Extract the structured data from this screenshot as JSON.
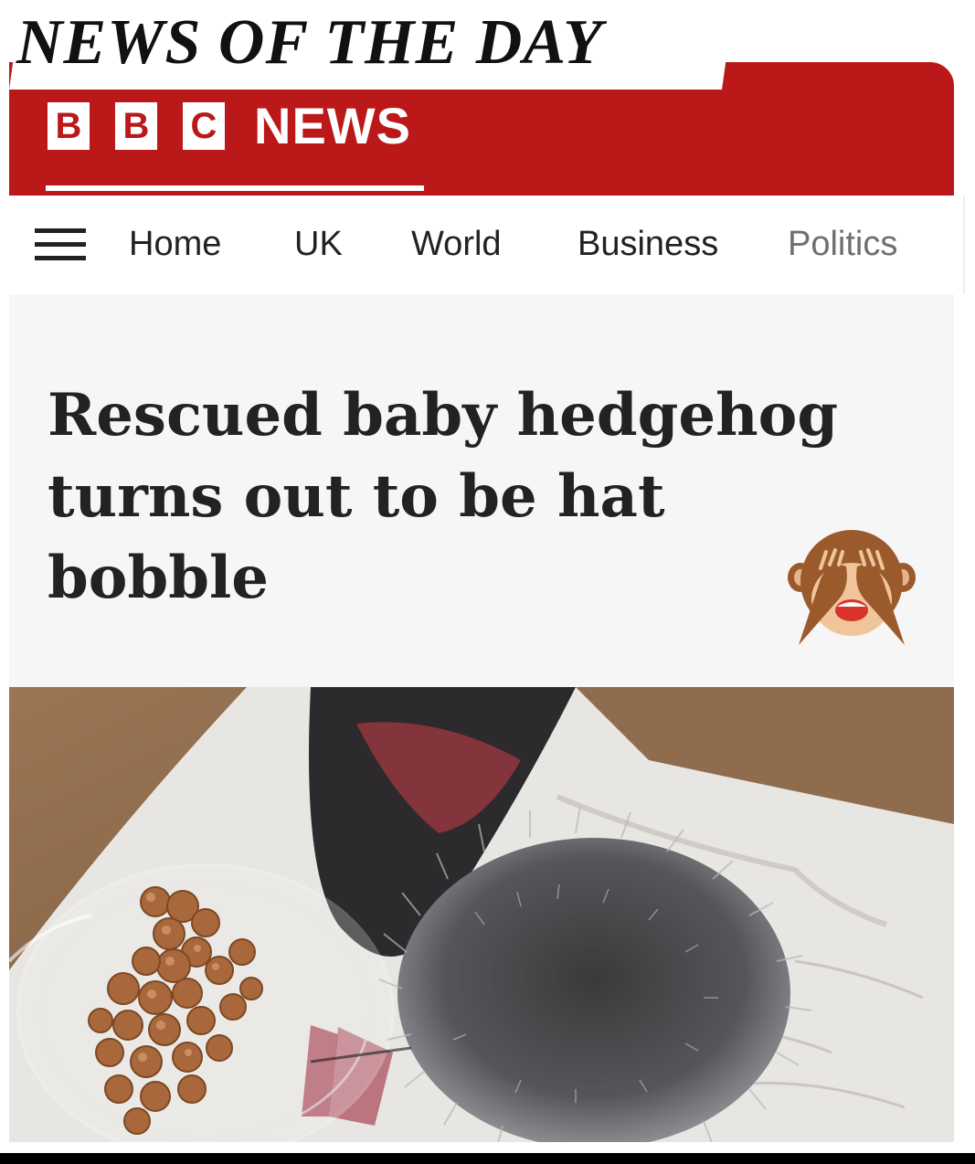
{
  "meme": {
    "title": "NEWS OF THE DAY"
  },
  "brand": {
    "letters": [
      "B",
      "B",
      "C"
    ],
    "news_label": "NEWS",
    "color": "#bb1919"
  },
  "nav": {
    "menu_icon": "hamburger-menu-icon",
    "items": [
      "Home",
      "UK",
      "World",
      "Business",
      "Politics"
    ]
  },
  "article": {
    "headline_lines": [
      "Rescued baby hedgehog",
      "turns out to be hat",
      "bobble"
    ],
    "reaction_emoji": "see-no-evil-monkey-icon",
    "image_subject": "hat-bobble-photo"
  }
}
